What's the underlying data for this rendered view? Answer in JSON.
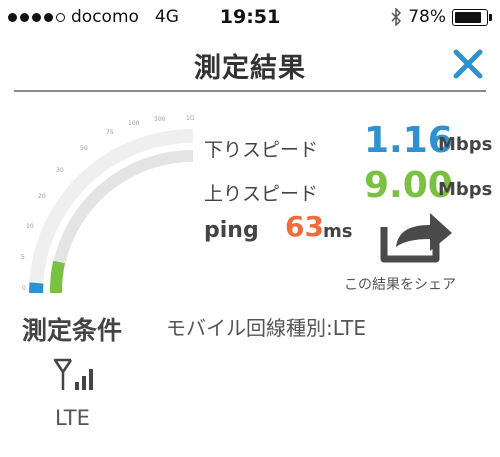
{
  "status_bar": {
    "carrier": "docomo",
    "network": "4G",
    "time": "19:51",
    "battery": "78%"
  },
  "nav": {
    "title": "測定結果"
  },
  "results": {
    "download_label": "下りスピード",
    "download_value": "1.16",
    "download_unit": "Mbps",
    "upload_label": "上りスピード",
    "upload_value": "9.00",
    "upload_unit": "Mbps",
    "ping_label": "ping",
    "ping_value": "63",
    "ping_unit": "ms"
  },
  "gauge": {
    "ticks": [
      "0",
      "5",
      "10",
      "20",
      "30",
      "50",
      "75",
      "100",
      "300",
      "1G"
    ]
  },
  "share": {
    "caption": "この結果をシェア"
  },
  "conditions": {
    "title": "測定条件",
    "type_text": "モバイル回線種別:LTE",
    "network_label": "LTE"
  },
  "colors": {
    "download": "#2f91d0",
    "upload": "#7ac143",
    "ping": "#ef6b3a"
  }
}
